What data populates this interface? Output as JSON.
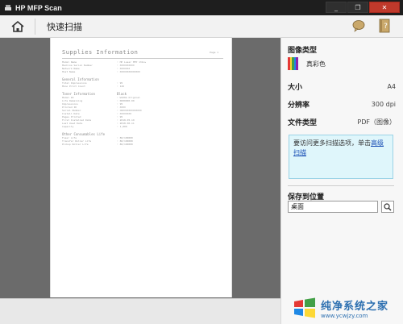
{
  "window": {
    "title": "HP MFP Scan",
    "minimize_label": "_",
    "maximize_label": "❐",
    "close_label": "✕"
  },
  "toolbar": {
    "breadcrumb": "快速扫描"
  },
  "document": {
    "title": "Supplies Information",
    "page_label": "Page 1",
    "header_rows": [
      {
        "k": "Model Name",
        "v": ": HP Laser MFP 131nw"
      },
      {
        "k": "Machine Serial Number",
        "v": ": XXXXXXXXXX"
      },
      {
        "k": "Network Name",
        "v": ": XXXXXXX"
      },
      {
        "k": "Host Name",
        "v": ": XXXXXXXXXXXXXX"
      }
    ],
    "general_title": "General Information",
    "general_rows": [
      {
        "k": "Total Impressions",
        "v": ": 95"
      },
      {
        "k": "Mono Print Count",
        "v": ": 126"
      }
    ],
    "toner_title": "Toner Information",
    "toner_heading": "Black",
    "toner_rows": [
      {
        "k": "Model ID",
        "v": ": W1X0A Original"
      },
      {
        "k": "Life Remaining",
        "v": ": 0000000.00"
      },
      {
        "k": "",
        "v": ""
      },
      {
        "k": "Impressions",
        "v": ": 95"
      },
      {
        "k": "Printed ID",
        "v": ": XXXX"
      },
      {
        "k": "Serial Number",
        "v": ": CNXXXXXXXXXXXXX"
      },
      {
        "k": "Install Date",
        "v": ": XXXXXXXX"
      },
      {
        "k": "Pages Printed",
        "v": ": 95"
      },
      {
        "k": "First Installed Date",
        "v": ": 2018.05.19"
      },
      {
        "k": "Last Used Date",
        "v": ": 2018.06.11"
      },
      {
        "k": "Capacity",
        "v": ": 1,000"
      }
    ],
    "other_title": "Other Consumables Life",
    "other_rows": [
      {
        "k": "Fuser Life",
        "v": ": 80/100000"
      },
      {
        "k": "Transfer Roller Life",
        "v": ": 80/100000"
      },
      {
        "k": "Pickup Roller Life",
        "v": ": 80/100000"
      }
    ]
  },
  "panel": {
    "image_type_label": "图像类型",
    "image_type_value": "真彩色",
    "size_label": "大小",
    "size_value": "A4",
    "resolution_label": "分辨率",
    "resolution_value": "300 dpi",
    "filetype_label": "文件类型",
    "filetype_value": "PDF（图像）",
    "info_text": "要访问更多扫描选项，单击",
    "info_link": "高级扫描",
    "save_label": "保存到位置",
    "save_value": "桌面"
  },
  "watermark": {
    "main": "纯净系统之家",
    "url": "www.ycwjzy.com"
  },
  "colors": {
    "titlebar": "#1e1e1e",
    "close_button": "#c0392b",
    "preview_bg": "#6b6b6b",
    "info_box_bg": "#dff6fb",
    "link": "#1a4fb5"
  }
}
